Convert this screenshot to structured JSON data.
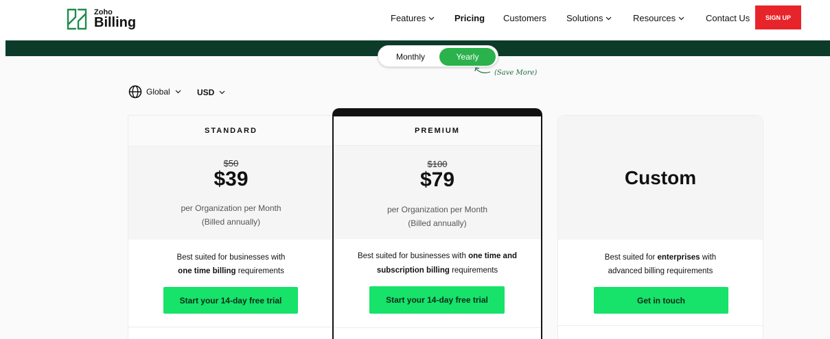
{
  "header": {
    "logo_small": "Zoho",
    "logo_big": "Billing",
    "nav": [
      {
        "label": "Features",
        "dropdown": true
      },
      {
        "label": "Pricing",
        "dropdown": false
      },
      {
        "label": "Customers",
        "dropdown": false
      },
      {
        "label": "Solutions",
        "dropdown": true
      },
      {
        "label": "Resources",
        "dropdown": true
      },
      {
        "label": "Contact Us",
        "dropdown": false
      }
    ],
    "signup_label": "SIGN UP"
  },
  "billing_toggle": {
    "monthly_label": "Monthly",
    "yearly_label": "Yearly",
    "selected": "Yearly",
    "save_note": "(Save More)"
  },
  "region": {
    "icon": "globe-icon",
    "label": "Global",
    "currency": "USD"
  },
  "plans": [
    {
      "name": "STANDARD",
      "old_price": "$50",
      "price": "$39",
      "per_line1": "per Organization per Month",
      "per_line2": "(Billed annually)",
      "desc_line1": "Best suited for businesses with",
      "desc_line2_bold": "one time billing",
      "desc_line2_rest": " requirements",
      "cta": "Start your 14-day free trial"
    },
    {
      "name": "PREMIUM",
      "old_price": "$100",
      "price": "$79",
      "per_line1": "per Organization per Month",
      "per_line2": "(Billed annually)",
      "desc_line1_pre": "Best suited for businesses with ",
      "desc_line1_bold": "one time and",
      "desc_line2_bold": "subscription billing",
      "desc_line2_rest": " requirements",
      "cta": "Start your 14-day free trial"
    },
    {
      "name": "Custom",
      "desc_line1_pre": "Best suited for ",
      "desc_line1_bold": "enterprises",
      "desc_line1_rest": " with",
      "desc_line2": "advanced billing requirements",
      "cta": "Get in touch"
    }
  ],
  "colors": {
    "brand_green_dark": "#0d3b2a",
    "toggle_green": "#2bb24c",
    "cta_green": "#17e26a",
    "signup_red": "#e8242b"
  }
}
